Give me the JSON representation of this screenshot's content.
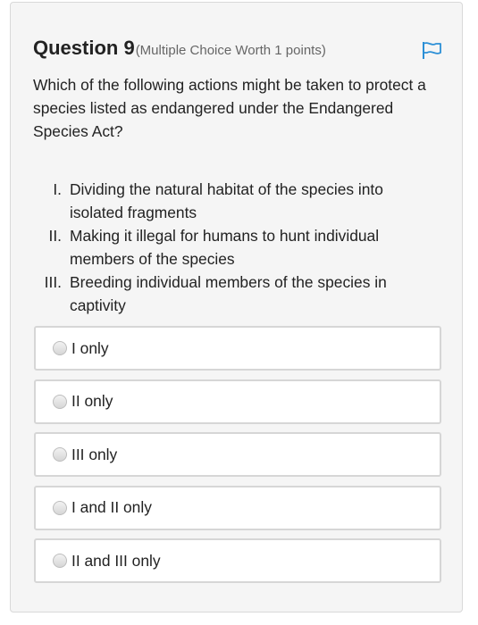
{
  "question": {
    "title": "Question 9",
    "worth": "(Multiple Choice Worth 1 points)",
    "flag_icon": "flag-icon",
    "stem": "Which of the following actions might be taken to protect a species listed as endangered under the Endangered Species Act?",
    "numbered_items": [
      {
        "label": "I.",
        "text": "Dividing the natural habitat of the species into isolated fragments"
      },
      {
        "label": "II.",
        "text": "Making it illegal for humans to hunt individual members of the species"
      },
      {
        "label": "III.",
        "text": "Breeding individual members of the species in captivity"
      }
    ],
    "options": [
      {
        "label": "I only",
        "selected": false
      },
      {
        "label": "II only",
        "selected": false
      },
      {
        "label": "III only",
        "selected": false
      },
      {
        "label": "I and II only",
        "selected": false
      },
      {
        "label": "II and III only",
        "selected": false
      }
    ]
  },
  "colors": {
    "flag": "#2b8fd6",
    "card_bg": "#f5f5f5",
    "option_border": "#d6d6d6"
  }
}
